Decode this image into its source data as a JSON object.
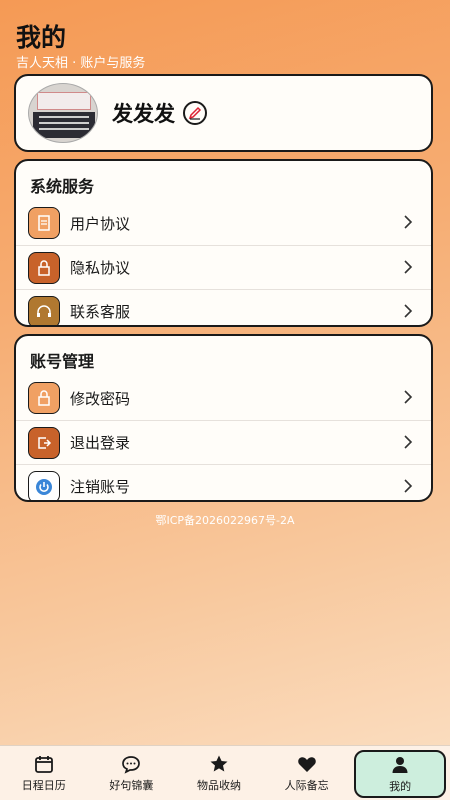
{
  "header": {
    "title": "我的",
    "subtitle": "吉人天相 · 账户与服务"
  },
  "profile": {
    "name": "发发发"
  },
  "system_services": {
    "title": "系统服务",
    "items": [
      {
        "label": "用户协议",
        "icon": "document-icon"
      },
      {
        "label": "隐私协议",
        "icon": "lock-icon"
      },
      {
        "label": "联系客服",
        "icon": "headset-icon"
      }
    ]
  },
  "account": {
    "title": "账号管理",
    "items": [
      {
        "label": "修改密码",
        "icon": "lock-icon"
      },
      {
        "label": "退出登录",
        "icon": "logout-icon"
      },
      {
        "label": "注销账号",
        "icon": "power-icon"
      }
    ]
  },
  "icp": "鄂ICP备2026022967号-2A",
  "tabs": [
    {
      "label": "日程日历",
      "icon": "calendar-icon"
    },
    {
      "label": "好句锦囊",
      "icon": "chat-icon"
    },
    {
      "label": "物品收纳",
      "icon": "star-icon"
    },
    {
      "label": "人际备忘",
      "icon": "heart-icon"
    },
    {
      "label": "我的",
      "icon": "person-icon",
      "active": true
    }
  ],
  "colors": {
    "icon_orange": "#f0a063",
    "icon_dark_orange": "#c8622a",
    "icon_brown": "#b07830",
    "tab_active_bg": "#cdeedd"
  }
}
